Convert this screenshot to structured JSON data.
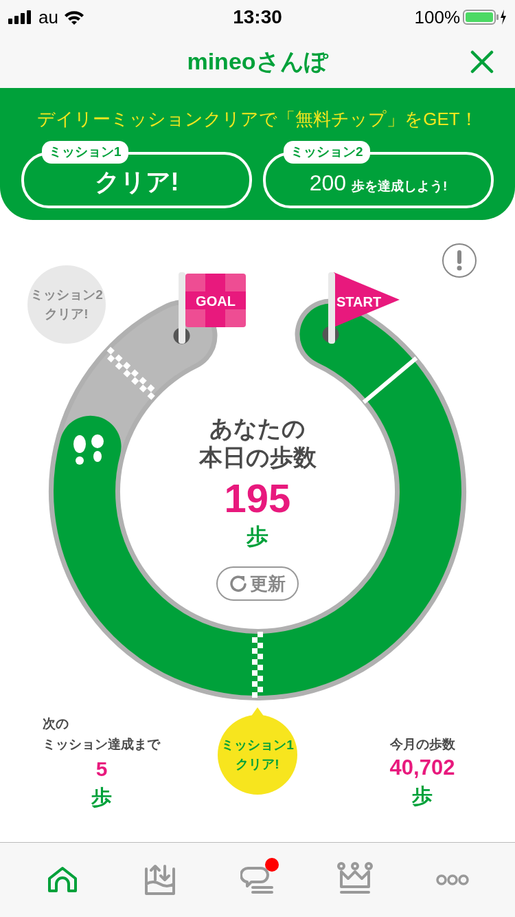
{
  "status_bar": {
    "carrier": "au",
    "time": "13:30",
    "battery": "100%"
  },
  "header": {
    "title": "mineoさんぽ"
  },
  "banner": {
    "headline": "デイリーミッションクリアで「無料チップ」をGET！",
    "missions": [
      {
        "kind": "cleared",
        "label": "ミッション1",
        "text": "クリア!"
      },
      {
        "kind": "goal",
        "label": "ミッション2",
        "count": "200",
        "text": "歩を達成しよう!"
      }
    ]
  },
  "track": {
    "start": "START",
    "goal": "GOAL",
    "bubbles": [
      {
        "lines": [
          "ミッション2",
          "クリア!"
        ],
        "achieved": false
      },
      {
        "lines": [
          "ミッション1",
          "クリア!"
        ],
        "achieved": true
      }
    ]
  },
  "today": {
    "label_lines": [
      "あなたの",
      "本日の歩数"
    ],
    "steps": "195",
    "unit": "歩",
    "refresh": "更新"
  },
  "next_mission": {
    "label_lines": [
      "次の",
      "ミッション達成まで"
    ],
    "value": "5",
    "unit": "歩"
  },
  "month": {
    "label": "今月の歩数",
    "value": "40,702",
    "unit": "歩"
  },
  "tabs": [
    {
      "kind": "home",
      "selected": true,
      "badge": false
    },
    {
      "kind": "exchange",
      "selected": false,
      "badge": false
    },
    {
      "kind": "chat",
      "selected": false,
      "badge": true
    },
    {
      "kind": "ranking",
      "selected": false,
      "badge": false
    },
    {
      "kind": "more",
      "selected": false,
      "badge": false
    }
  ]
}
